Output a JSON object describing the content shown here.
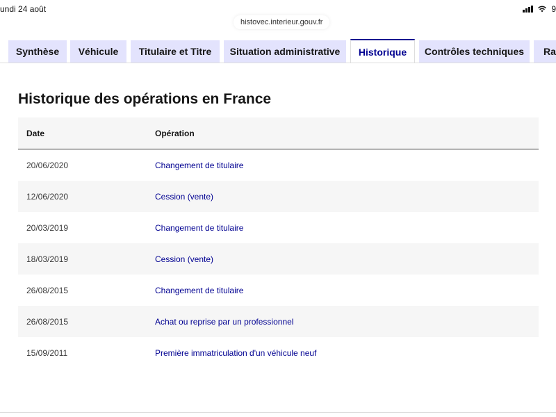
{
  "status_bar": {
    "date": "undi 24 août",
    "battery": "9"
  },
  "browser": {
    "url": "histovec.interieur.gouv.fr"
  },
  "tabs": [
    {
      "label": "Synthèse",
      "active": false
    },
    {
      "label": "Véhicule",
      "active": false
    },
    {
      "label": "Titulaire et Titre",
      "active": false
    },
    {
      "label": "Situation administrative",
      "active": false
    },
    {
      "label": "Historique",
      "active": true
    },
    {
      "label": "Contrôles techniques",
      "active": false
    },
    {
      "label": "Rap",
      "active": false
    }
  ],
  "main": {
    "title": "Historique des opérations en France",
    "table": {
      "headers": {
        "date": "Date",
        "operation": "Opération"
      },
      "rows": [
        {
          "date": "20/06/2020",
          "operation": "Changement de titulaire"
        },
        {
          "date": "12/06/2020",
          "operation": "Cession (vente)"
        },
        {
          "date": "20/03/2019",
          "operation": "Changement de titulaire"
        },
        {
          "date": "18/03/2019",
          "operation": "Cession (vente)"
        },
        {
          "date": "26/08/2015",
          "operation": "Changement de titulaire"
        },
        {
          "date": "26/08/2015",
          "operation": "Achat ou reprise par un professionnel"
        },
        {
          "date": "15/09/2011",
          "operation": "Première immatriculation d'un véhicule neuf"
        }
      ]
    }
  },
  "colors": {
    "accent": "#000091",
    "tab_bg": "#e3e3fd",
    "row_alt": "#f6f6f6"
  }
}
